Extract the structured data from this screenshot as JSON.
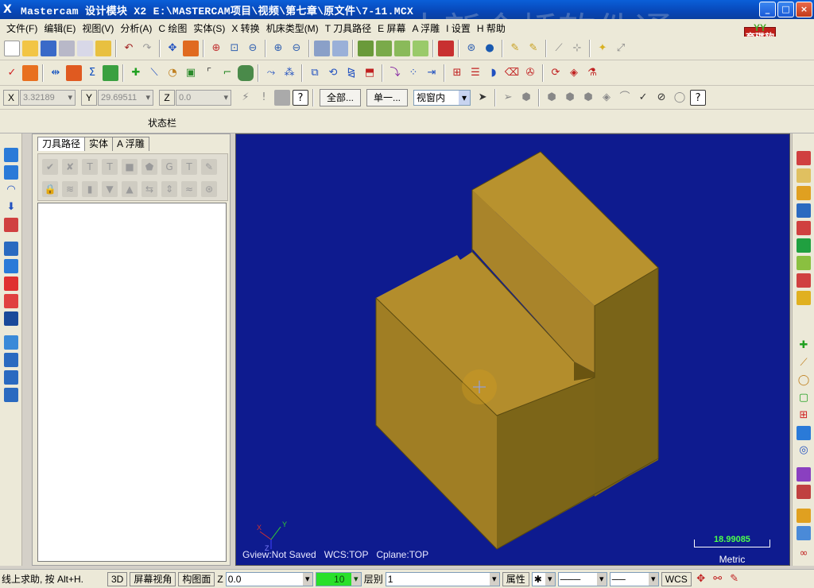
{
  "window": {
    "title": "Mastercam 设计模块  X2  E:\\MASTERCAM项目\\视频\\第七章\\原文件\\7-11.MCX",
    "icon": "X",
    "watermark": "中新金桥软件通",
    "logo_top": "YY",
    "logo_text": "育碟软件",
    "minimize": "_",
    "maximize": "□",
    "close": "×"
  },
  "menu": [
    "文件(F)",
    "编辑(E)",
    "视图(V)",
    "分析(A)",
    "C 绘图",
    "实体(S)",
    "X 转换",
    "机床类型(M)",
    "T 刀具路径",
    "E 屏幕",
    "A 浮雕",
    "I 设置",
    "H 帮助"
  ],
  "toolbar3": {
    "x_label": "X",
    "x_value": "3.32189",
    "y_label": "Y",
    "y_value": "29.69511",
    "z_label": "Z",
    "z_value": "0.0",
    "all_button": "全部...",
    "single_button": "单一...",
    "view_select": "视窗内"
  },
  "status_label": "状态栏",
  "manager": {
    "tabs": [
      "刀具路径",
      "实体",
      "A 浮雕"
    ]
  },
  "viewport": {
    "gview": "Gview:Not Saved",
    "wcs": "WCS:TOP",
    "cplane": "Cplane:TOP",
    "scale_value": "18.99085",
    "scale_unit": "Metric",
    "axis_x": "X",
    "axis_y": "Y",
    "axis_z": "Z",
    "colors": {
      "background": "#0e1b8f",
      "solid_top": "#b8922e",
      "solid_left": "#a9842a",
      "solid_right": "#7a6418"
    }
  },
  "bottom": {
    "prompt": "线上求助, 按 Alt+H.",
    "btn_3d": "3D",
    "screen_view": "屏幕视角",
    "cplane": "构图面",
    "z_label": "Z",
    "z_value": "0.0",
    "color_value": "10",
    "layer_label": "层别",
    "layer_value": "1",
    "attr_label": "属性",
    "wcs": "WCS"
  }
}
